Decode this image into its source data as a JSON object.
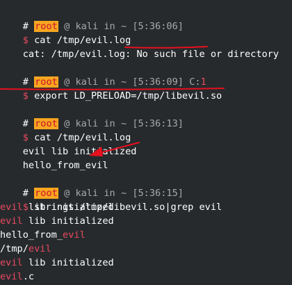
{
  "prompts": [
    {
      "hash": "#",
      "user": "root",
      "at": "@",
      "host": "kali",
      "in": "in",
      "dir": "~",
      "time": "[5:36:06]",
      "extra": ""
    },
    {
      "hash": "#",
      "user": "root",
      "at": "@",
      "host": "kali",
      "in": "in",
      "dir": "~",
      "time": "[5:36:09]",
      "extra": "C:",
      "extra_code": "1"
    },
    {
      "hash": "#",
      "user": "root",
      "at": "@",
      "host": "kali",
      "in": "in",
      "dir": "~",
      "time": "[5:36:13]",
      "extra": ""
    },
    {
      "hash": "#",
      "user": "root",
      "at": "@",
      "host": "kali",
      "in": "in",
      "dir": "~",
      "time": "[5:36:15]",
      "extra": ""
    }
  ],
  "dollar": "$",
  "commands": [
    "cat /tmp/evil.log",
    "export LD_PRELOAD=/tmp/libevil.so",
    "cat /tmp/evil.log",
    "strings /tmp/libevil.so|grep evil"
  ],
  "output1": {
    "prefix": "cat: /tmp/evil.log: ",
    "highlight": "No such file",
    "suffix": " or directory"
  },
  "output3": [
    "evil lib initialized",
    "hello_from_evil"
  ],
  "output4": [
    {
      "parts": [
        {
          "text": "evil",
          "style": "red"
        },
        {
          "text": " lib initialized",
          "style": "white"
        }
      ]
    },
    {
      "parts": [
        {
          "text": "evil",
          "style": "red"
        },
        {
          "text": " lib initialized",
          "style": "white"
        }
      ]
    },
    {
      "parts": [
        {
          "text": "hello_from_",
          "style": "white"
        },
        {
          "text": "evil",
          "style": "red"
        }
      ]
    },
    {
      "parts": [
        {
          "text": "/tmp/",
          "style": "white"
        },
        {
          "text": "evil",
          "style": "red"
        }
      ]
    },
    {
      "parts": [
        {
          "text": "evil",
          "style": "red"
        },
        {
          "text": " lib initialized",
          "style": "white"
        }
      ]
    },
    {
      "parts": [
        {
          "text": "evil",
          "style": "red"
        },
        {
          "text": ".c",
          "style": "white"
        }
      ]
    }
  ],
  "colors": {
    "background": "#272a2d",
    "root_badge_bg": "#f7a620",
    "root_badge_fg": "#c8102e",
    "accent_red": "#e84a5f",
    "annotation_red": "#e8101e",
    "timestamp": "#a8a8a8"
  }
}
